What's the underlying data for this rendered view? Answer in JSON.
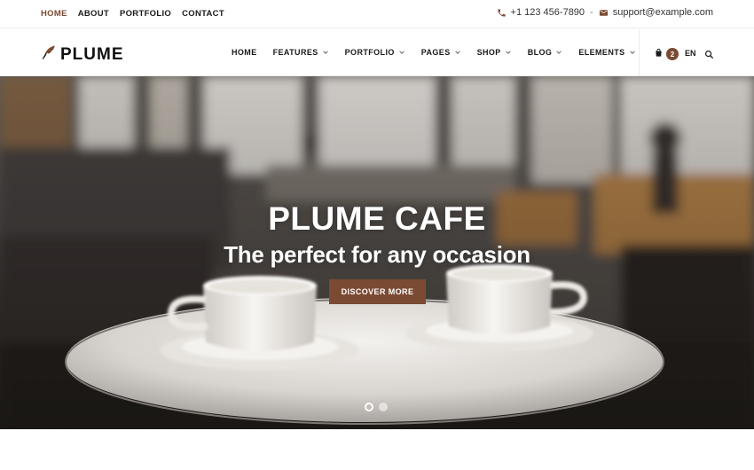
{
  "topbar": {
    "nav": [
      "HOME",
      "ABOUT",
      "PORTFOLIO",
      "CONTACT"
    ],
    "phone": "+1 123 456-7890",
    "separator": "-",
    "email": "support@example.com",
    "icons": {
      "phone": "phone-icon",
      "email": "envelope-icon"
    }
  },
  "header": {
    "logo_text": "PLUME",
    "logo_icon": "feather-icon",
    "nav": [
      {
        "label": "HOME",
        "has_dropdown": false
      },
      {
        "label": "FEATURES",
        "has_dropdown": true
      },
      {
        "label": "PORTFOLIO",
        "has_dropdown": true
      },
      {
        "label": "PAGES",
        "has_dropdown": true
      },
      {
        "label": "SHOP",
        "has_dropdown": true
      },
      {
        "label": "BLOG",
        "has_dropdown": true
      },
      {
        "label": "ELEMENTS",
        "has_dropdown": true
      }
    ],
    "cart_count": "2",
    "language": "EN"
  },
  "hero": {
    "title": "PLUME CAFE",
    "subtitle": "The perfect for any occasion",
    "cta_label": "DISCOVER MORE",
    "slides_total": 2,
    "active_slide": 1
  },
  "colors": {
    "accent": "#7b4a33",
    "active_top_nav": "#7b4a33",
    "text_dark": "#1a1a1a"
  }
}
